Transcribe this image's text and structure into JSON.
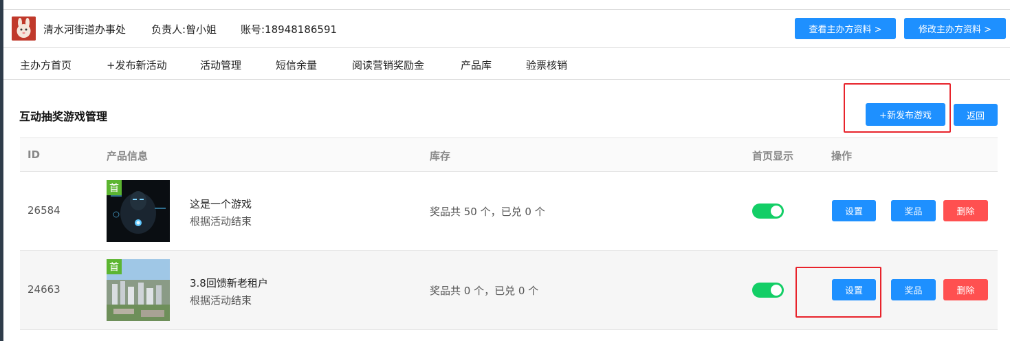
{
  "header": {
    "org_name": "清水河街道办事处",
    "contact": "负责人:曾小姐",
    "account": "账号:18948186591",
    "view_btn": "查看主办方资料 >",
    "edit_btn": "修改主办方资料 >"
  },
  "nav": {
    "items": [
      "主办方首页",
      "+发布新活动",
      "活动管理",
      "短信余量",
      "阅读营销奖励金",
      "产品库",
      "验票核销"
    ]
  },
  "section": {
    "title": "互动抽奖游戏管理",
    "new_game_btn": "+新发布游戏",
    "back_btn": "返回"
  },
  "table": {
    "headers": [
      "ID",
      "产品信息",
      "库存",
      "首页显示",
      "操作"
    ],
    "rows": [
      {
        "id": "26584",
        "badge": "首",
        "name": "这是一个游戏",
        "sub": "根据活动结束",
        "stock": "奖品共 50 个，已兑 0 个",
        "homepage_on": true,
        "actions": [
          "设置",
          "奖品",
          "删除"
        ]
      },
      {
        "id": "24663",
        "badge": "首",
        "name": "3.8回馈新老租户",
        "sub": "根据活动结束",
        "stock": "奖品共 0 个，已兑 0 个",
        "homepage_on": true,
        "actions": [
          "设置",
          "奖品",
          "删除"
        ]
      }
    ]
  },
  "colors": {
    "primary": "#1e90ff",
    "danger": "#ff5050",
    "toggle_on": "#13ce66",
    "highlight": "#e8232b",
    "badge": "#5cb531"
  }
}
